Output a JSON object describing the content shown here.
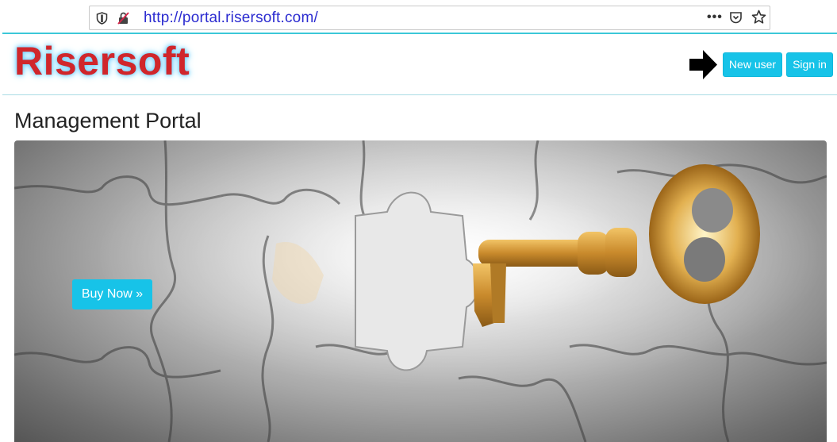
{
  "browser": {
    "url": "http://portal.risersoft.com/",
    "more_label": "•••"
  },
  "navbar": {
    "logo_text": "Risersoft",
    "new_user_label": "New user",
    "sign_in_label": "Sign in"
  },
  "main": {
    "page_title": "Management Portal",
    "hero": {
      "cta_label": "Buy Now »"
    }
  },
  "colors": {
    "accent": "#17c3e8",
    "logo_red": "#d0262b",
    "url_blue": "#2b2bd0"
  }
}
